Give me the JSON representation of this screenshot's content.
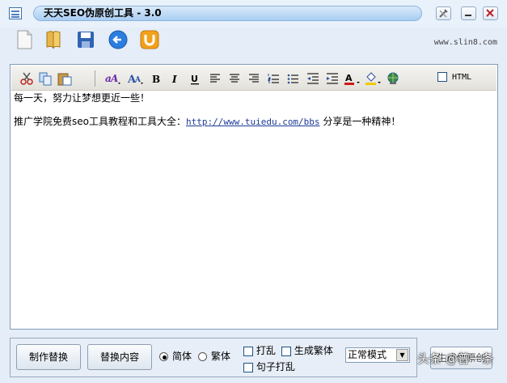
{
  "window": {
    "title": "天天SEO伪原创工具 - 3.0"
  },
  "toolbar": {
    "site": "www.slin8.com"
  },
  "editor": {
    "html_label": "HTML",
    "line1": "每一天，努力让梦想更近一些！",
    "line2_prefix": "推广学院免费seo工具教程和工具大全：",
    "line2_link": "http://www.tuiedu.com/bbs",
    "line2_suffix": " 分享是一种精神！"
  },
  "bottom": {
    "make_replace": "制作替换",
    "replace_content": "替换内容",
    "simplified": "简体",
    "traditional": "繁体",
    "shuffle": "打乱",
    "gen_traditional": "生成繁体",
    "sentence_shuffle": "句子打乱",
    "mode": "正常模式",
    "generate": "生成伪原创"
  },
  "watermark": "头条 @普一条",
  "colors": {
    "link": "#1c3a97",
    "title_pill": "#a9cdf1",
    "background": "#e4edf8"
  }
}
